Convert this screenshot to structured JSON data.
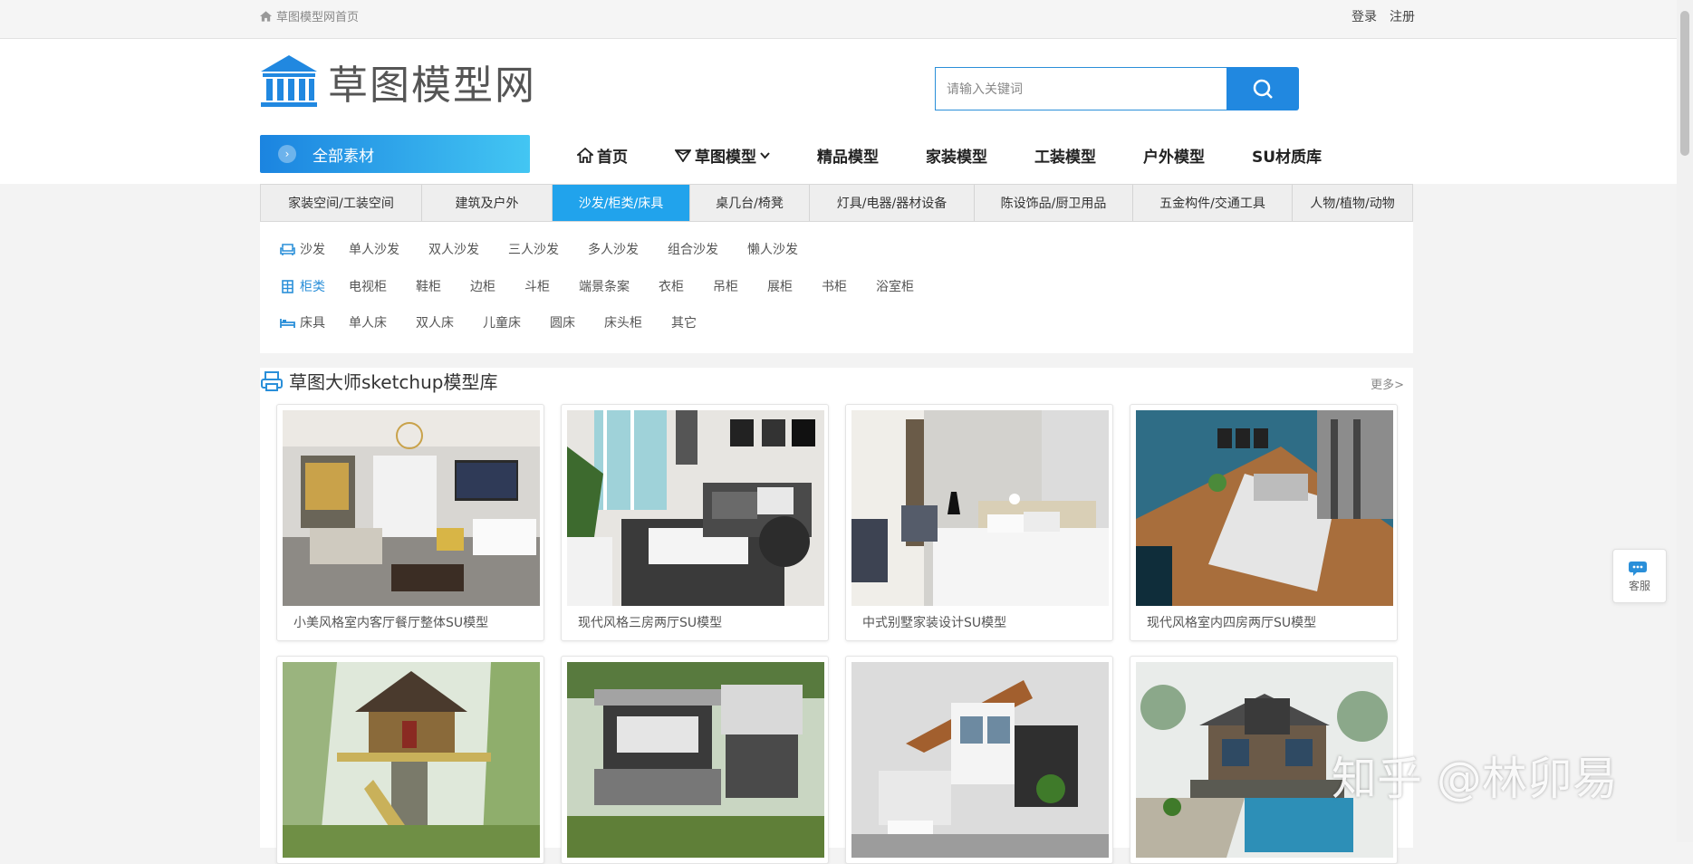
{
  "topbar": {
    "home_text": "草图模型网首页",
    "login": "登录",
    "register": "注册"
  },
  "logo": {
    "text": "草图模型网"
  },
  "search": {
    "placeholder": "请输入关键词"
  },
  "all_category": {
    "label": "全部素材"
  },
  "main_nav": [
    {
      "label": "首页",
      "icon": "home-icon"
    },
    {
      "label": "草图模型",
      "icon": "diamond-icon",
      "has_dropdown": true
    },
    {
      "label": "精品模型"
    },
    {
      "label": "家装模型"
    },
    {
      "label": "工装模型"
    },
    {
      "label": "户外模型"
    },
    {
      "label": "SU材质库"
    }
  ],
  "category_tabs": [
    {
      "label": "家装空间/工装空间"
    },
    {
      "label": "建筑及户外"
    },
    {
      "label": "沙发/柜类/床具",
      "active": true
    },
    {
      "label": "桌几台/椅凳"
    },
    {
      "label": "灯具/电器/器材设备"
    },
    {
      "label": "陈设饰品/厨卫用品"
    },
    {
      "label": "五金构件/交通工具"
    },
    {
      "label": "人物/植物/动物"
    }
  ],
  "sub_categories": [
    {
      "head": "沙发",
      "icon": "sofa-icon",
      "highlight": false,
      "items": [
        "单人沙发",
        "双人沙发",
        "三人沙发",
        "多人沙发",
        "组合沙发",
        "懒人沙发"
      ]
    },
    {
      "head": "柜类",
      "icon": "cabinet-icon",
      "highlight": true,
      "items": [
        "电视柜",
        "鞋柜",
        "边柜",
        "斗柜",
        "端景条案",
        "衣柜",
        "吊柜",
        "展柜",
        "书柜",
        "浴室柜"
      ]
    },
    {
      "head": "床具",
      "icon": "bed-icon",
      "highlight": false,
      "items": [
        "单人床",
        "双人床",
        "儿童床",
        "圆床",
        "床头柜",
        "其它"
      ]
    }
  ],
  "section": {
    "title": "草图大师sketchup模型库",
    "more": "更多>"
  },
  "cards": [
    {
      "caption": "小美风格室内客厅餐厅整体SU模型"
    },
    {
      "caption": "现代风格三房两厅SU模型"
    },
    {
      "caption": "中式别墅家装设计SU模型"
    },
    {
      "caption": "现代风格室内四房两厅SU模型"
    },
    {
      "caption": ""
    },
    {
      "caption": ""
    },
    {
      "caption": ""
    },
    {
      "caption": ""
    }
  ],
  "service": {
    "label": "客服"
  },
  "watermark": "知乎 @林卯易",
  "colors": {
    "accent": "#2188e0",
    "active_tab": "#21a3ec"
  }
}
